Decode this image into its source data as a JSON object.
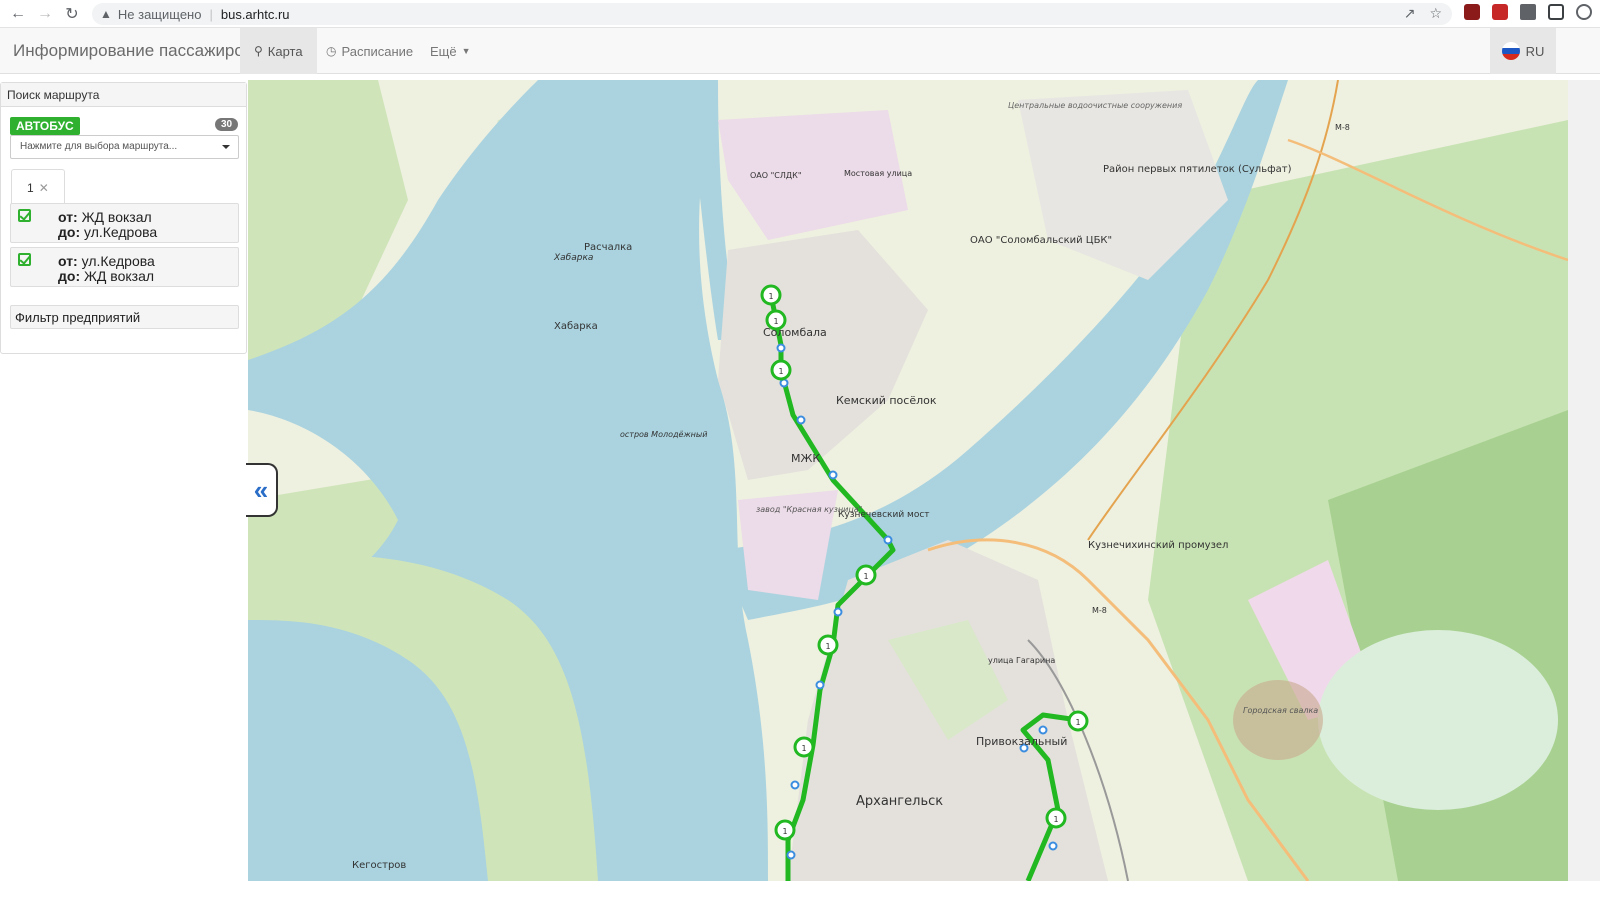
{
  "browser": {
    "insecure_label": "Не защищено",
    "url": "bus.arhtc.ru"
  },
  "header": {
    "brand": "Информирование пассажиров",
    "menu": {
      "map": "Карта",
      "schedule": "Расписание",
      "more": "Ещё"
    },
    "lang": "RU"
  },
  "sidebar": {
    "title": "Поиск маршрута",
    "transport_type": "АВТОБУС",
    "route_count": "30",
    "select_placeholder": "Нажмите для выбора маршрута...",
    "selected_route": "1",
    "directions": [
      {
        "from_label": "от:",
        "from": "ЖД вокзал",
        "to_label": "до:",
        "to": "ул.Кедрова"
      },
      {
        "from_label": "от:",
        "from": "ул.Кедрова",
        "to_label": "до:",
        "to": "ЖД вокзал"
      }
    ],
    "filter_label": "Фильтр предприятий"
  },
  "map": {
    "labels": {
      "solombala": "Соломбала",
      "kemsky": "Кемский посёлок",
      "mzhk": "МЖК",
      "kuznechevsky": "Кузнечевский мост",
      "arkhangelsk": "Архангельск",
      "privokzalny": "Привокзальный",
      "kuznechikhinsky": "Кузнечихинский промузел",
      "rayon_pervykh": "Район первых пятилеток (Сульфат)",
      "tsbk": "ОАО \"Соломбальский ЦБК\"",
      "raschalka": "Расчалка",
      "khabarka1": "Хабарка",
      "khabarka2": "Хабарка",
      "molodezhny": "остров Молодёжный",
      "kegostrov": "Кегостров",
      "sldk": "ОАО \"СЛДК\"",
      "vodoochistnye": "Центральные водоочистные сооружения",
      "krasnaya_kuznitsa": "завод \"Красная кузница\"",
      "gorodskaya_svalka": "Городская свалка",
      "m8_1": "М-8",
      "m8_2": "М-8",
      "gagarina": "улица Гагарина",
      "mostovaya": "Мостовая улица",
      "route_number": "1"
    },
    "colors": {
      "water": "#aad3df",
      "land": "#f2efe9",
      "green": "#c8e3b3",
      "forest": "#add19e",
      "industrial": "#ebdbe8",
      "route": "#22b822",
      "stop": "#3b8de0"
    }
  }
}
